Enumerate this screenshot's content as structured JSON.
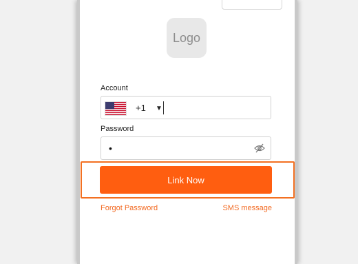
{
  "logo": {
    "label": "Logo"
  },
  "account": {
    "label": "Account",
    "country_code": "+1",
    "value": ""
  },
  "password": {
    "label": "Password",
    "masked_value": "•"
  },
  "actions": {
    "link_now_label": "Link Now",
    "forgot_password_label": "Forgot Password",
    "sms_message_label": "SMS message"
  },
  "icons": {
    "flag": "us-flag-icon",
    "dropdown": "caret-down-icon",
    "visibility": "eye-slash-icon"
  },
  "colors": {
    "primary": "#ff5e10",
    "link": "#f26a22",
    "highlight": "#f37021"
  }
}
